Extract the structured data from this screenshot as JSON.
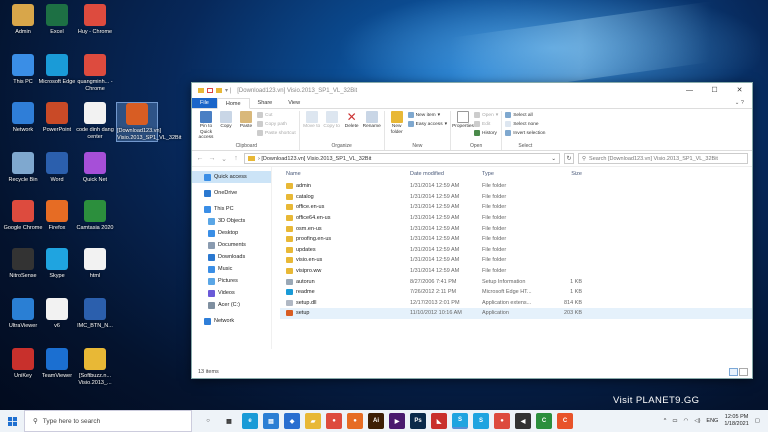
{
  "desktop": {
    "icons": [
      {
        "label": "Admin",
        "color": "#d8a64a"
      },
      {
        "label": "Excel",
        "color": "#1d7044"
      },
      {
        "label": "Huy - Chrome",
        "color": "#dd4b3e"
      },
      {
        "label": "This PC",
        "color": "#3a8ee6"
      },
      {
        "label": "Microsoft Edge",
        "color": "#1a9bd7"
      },
      {
        "label": "quangminh... - Chrome",
        "color": "#dd4b3e"
      },
      {
        "label": "Network",
        "color": "#2f7ed8"
      },
      {
        "label": "PowerPoint",
        "color": "#c94a27"
      },
      {
        "label": "code dinh dang center",
        "color": "#f2f2f2"
      },
      {
        "label": "[Download123.vn] Visio.2013_SP1_VL_32Bit",
        "color": "#d85d23"
      },
      {
        "label": "Recycle Bin",
        "color": "#7fa8cf"
      },
      {
        "label": "Word",
        "color": "#2b5fad"
      },
      {
        "label": "Quick Net",
        "color": "#a64fd8"
      },
      {
        "label": "Google Chrome",
        "color": "#dd4b3e"
      },
      {
        "label": "Firefox",
        "color": "#e66c24"
      },
      {
        "label": "Camtasia 2020",
        "color": "#2c8f3d"
      },
      {
        "label": "NitroSense",
        "color": "#333333"
      },
      {
        "label": "Skype",
        "color": "#1fa4e0"
      },
      {
        "label": "html",
        "color": "#f2f2f2"
      },
      {
        "label": "UltraViewer",
        "color": "#2a7fd4"
      },
      {
        "label": "v6",
        "color": "#f2f2f2"
      },
      {
        "label": "IMC_BTN_N...",
        "color": "#2b5fad"
      },
      {
        "label": "UniKey",
        "color": "#c8302c"
      },
      {
        "label": "TeamViewer",
        "color": "#1b6fd1"
      },
      {
        "label": "[Softbuzz.n... Visio.2013_...",
        "color": "#e8b836"
      }
    ]
  },
  "window": {
    "title": "[Download123.vn] Visio.2013_SP1_VL_32Bit",
    "controls": {
      "minimize": "—",
      "maximize": "☐",
      "close": "✕"
    },
    "tabs": [
      "File",
      "Home",
      "Share",
      "View"
    ],
    "ribbon": {
      "clipboard": {
        "label": "Clipboard",
        "pin": "Pin to Quick access",
        "copy": "Copy",
        "paste": "Paste",
        "cut": "Cut",
        "copy_path": "Copy path",
        "paste_shortcut": "Paste shortcut"
      },
      "organize": {
        "label": "Organize",
        "move_to": "Move to",
        "copy_to": "Copy to",
        "delete": "Delete",
        "rename": "Rename"
      },
      "new": {
        "label": "New",
        "new_folder": "New folder",
        "new_item": "New item",
        "easy_access": "Easy access"
      },
      "open": {
        "label": "Open",
        "properties": "Properties",
        "open": "Open",
        "edit": "Edit",
        "history": "History"
      },
      "select": {
        "label": "Select",
        "select_all": "Select all",
        "select_none": "Select none",
        "invert": "Invert selection"
      }
    },
    "address": {
      "path": "› [Download123.vn] Visio.2013_SP1_VL_32Bit",
      "search_placeholder": "Search [Download123.vn] Visio.2013_SP1_VL_32Bit"
    },
    "nav_pane": [
      {
        "label": "Quick access",
        "color": "#3a8ee6",
        "sel": true
      },
      {
        "label": "OneDrive",
        "color": "#2a78d0"
      },
      {
        "label": "This PC",
        "color": "#3a8ee6"
      },
      {
        "label": "3D Objects",
        "color": "#5aa6e6",
        "sub": true
      },
      {
        "label": "Desktop",
        "color": "#3a8ee6",
        "sub": true
      },
      {
        "label": "Documents",
        "color": "#8a9bb0",
        "sub": true
      },
      {
        "label": "Downloads",
        "color": "#2a78d0",
        "sub": true
      },
      {
        "label": "Music",
        "color": "#3a8ee6",
        "sub": true
      },
      {
        "label": "Pictures",
        "color": "#5aa6e6",
        "sub": true
      },
      {
        "label": "Videos",
        "color": "#6a5ad8",
        "sub": true
      },
      {
        "label": "Acer (C:)",
        "color": "#7f8fa0",
        "sub": true
      },
      {
        "label": "Network",
        "color": "#2f7ed8"
      }
    ],
    "columns": {
      "name": "Name",
      "date": "Date modified",
      "type": "Type",
      "size": "Size"
    },
    "files": [
      {
        "name": "admin",
        "date": "1/31/2014 12:59 AM",
        "type": "File folder",
        "size": "",
        "color": "#e8b836"
      },
      {
        "name": "catalog",
        "date": "1/31/2014 12:59 AM",
        "type": "File folder",
        "size": "",
        "color": "#e8b836"
      },
      {
        "name": "office.en-us",
        "date": "1/31/2014 12:59 AM",
        "type": "File folder",
        "size": "",
        "color": "#e8b836"
      },
      {
        "name": "office64.en-us",
        "date": "1/31/2014 12:59 AM",
        "type": "File folder",
        "size": "",
        "color": "#e8b836"
      },
      {
        "name": "osm.en-us",
        "date": "1/31/2014 12:59 AM",
        "type": "File folder",
        "size": "",
        "color": "#e8b836"
      },
      {
        "name": "proofing.en-us",
        "date": "1/31/2014 12:59 AM",
        "type": "File folder",
        "size": "",
        "color": "#e8b836"
      },
      {
        "name": "updates",
        "date": "1/31/2014 12:59 AM",
        "type": "File folder",
        "size": "",
        "color": "#e8b836"
      },
      {
        "name": "visio.en-us",
        "date": "1/31/2014 12:59 AM",
        "type": "File folder",
        "size": "",
        "color": "#e8b836"
      },
      {
        "name": "visipro.ww",
        "date": "1/31/2014 12:59 AM",
        "type": "File folder",
        "size": "",
        "color": "#e8b836"
      },
      {
        "name": "autorun",
        "date": "8/27/2006 7:41 PM",
        "type": "Setup Information",
        "size": "1 KB",
        "color": "#9aa8b6"
      },
      {
        "name": "readme",
        "date": "7/26/2012 2:11 PM",
        "type": "Microsoft Edge HT...",
        "size": "1 KB",
        "color": "#1a9bd7"
      },
      {
        "name": "setup.dll",
        "date": "12/17/2013 2:01 PM",
        "type": "Application extens...",
        "size": "814 KB",
        "color": "#b0b8c4"
      },
      {
        "name": "setup",
        "date": "11/10/2012 10:16 AM",
        "type": "Application",
        "size": "203 KB",
        "color": "#d85d23",
        "sel": true
      }
    ],
    "status": "13 items"
  },
  "taskbar": {
    "search_placeholder": "Type here to search",
    "apps": [
      {
        "glyph": "○",
        "color": "#eef3f8"
      },
      {
        "glyph": "▦",
        "color": "#eef3f8"
      },
      {
        "glyph": "e",
        "color": "#1a9bd7"
      },
      {
        "glyph": "▤",
        "color": "#2b7fd4"
      },
      {
        "glyph": "◆",
        "color": "#2a6fd0"
      },
      {
        "glyph": "▰",
        "color": "#e8b836"
      },
      {
        "glyph": "●",
        "color": "#dd4b3e"
      },
      {
        "glyph": "●",
        "color": "#e66c24"
      },
      {
        "glyph": "Ai",
        "color": "#3d1f05"
      },
      {
        "glyph": "▶",
        "color": "#4a1a6e"
      },
      {
        "glyph": "Ps",
        "color": "#0b2a4a"
      },
      {
        "glyph": "◣",
        "color": "#c9302c"
      },
      {
        "glyph": "S",
        "color": "#1fa4e0",
        "act": true
      },
      {
        "glyph": "S",
        "color": "#1fa4e0"
      },
      {
        "glyph": "●",
        "color": "#dd4b3e"
      },
      {
        "glyph": "◀",
        "color": "#333"
      },
      {
        "glyph": "C",
        "color": "#2c8f3d"
      },
      {
        "glyph": "C",
        "color": "#e8532a"
      }
    ],
    "tray": {
      "up": "^",
      "lang": "ENG",
      "time": "12:05 PM",
      "date": "1/18/2021"
    }
  },
  "watermark": "Visit PLANET9.GG"
}
